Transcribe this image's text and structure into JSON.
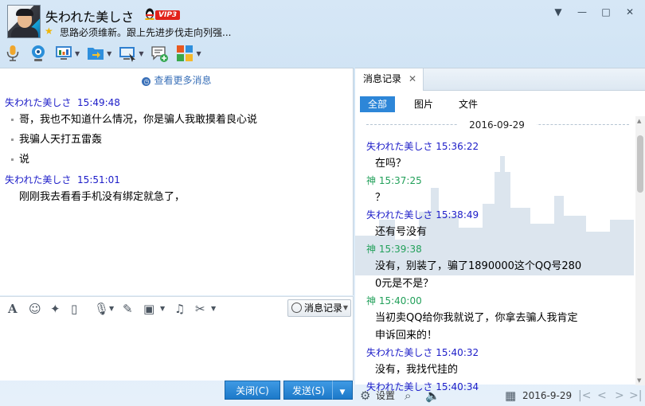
{
  "header": {
    "contact_name": "失われた美しさ",
    "vip_label": "VIP3",
    "signature": "思路必须维新。跟上先进步伐走向列强..."
  },
  "window_controls": {
    "skin": "▼",
    "minimize": "—",
    "maximize": "□",
    "close": "✕"
  },
  "chat": {
    "more_messages": "查看更多消息",
    "messages": [
      {
        "sender": "失われた美しさ",
        "time": "15:49:48"
      },
      {
        "text": "哥，我也不知道什么情况，你是骗人我敢摸着良心说"
      },
      {
        "text": "我骗人天打五雷轰"
      },
      {
        "text": "说"
      },
      {
        "sender": "失われた美しさ",
        "time": "15:51:01"
      },
      {
        "text": "刚刚我去看看手机没有绑定就急了，"
      }
    ]
  },
  "input_toolbar": {
    "history_button": "消息记录"
  },
  "buttons": {
    "close": "关闭(C)",
    "send": "发送(S)"
  },
  "history_panel": {
    "tab_label": "消息记录",
    "filters": [
      "全部",
      "图片",
      "文件"
    ],
    "date": "2016-09-29",
    "entries": [
      {
        "sender": "失われた美しさ",
        "time": "15:36:22",
        "text": "在吗？"
      },
      {
        "sender": "神",
        "time": "15:37:25",
        "text": "？"
      },
      {
        "sender": "失われた美しさ",
        "time": "15:38:49",
        "text": "还有号没有"
      },
      {
        "sender": "神",
        "time": "15:39:38",
        "text_line1": "没有，别装了，骗了1890000这个QQ号280",
        "text_line2": "0元是不是？"
      },
      {
        "sender": "神",
        "time": "15:40:00",
        "text_line1": "当初卖QQ给你我就说了，你拿去骗人我肯定",
        "text_line2": "申诉回来的！"
      },
      {
        "sender": "失われた美しさ",
        "time": "15:40:32",
        "text": "没有，我找代挂的"
      },
      {
        "sender": "失われた美しさ",
        "time": "15:40:34"
      }
    ],
    "settings_label": "设置",
    "bottom_date": "2016-9-29"
  }
}
